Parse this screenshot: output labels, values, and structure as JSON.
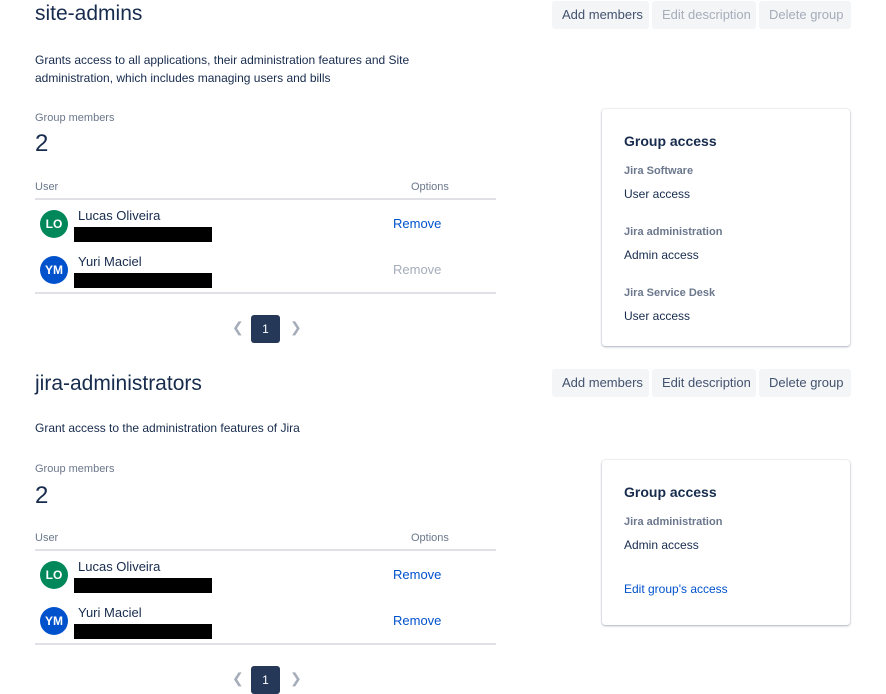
{
  "groups": [
    {
      "name": "site-admins",
      "buttons": {
        "add": "Add members",
        "edit": "Edit description",
        "delete": "Delete group"
      },
      "description": "Grants access to all applications, their administration features and Site administration, which includes managing users and bills",
      "members_label": "Group members",
      "members_count": "2",
      "table": {
        "col_user": "User",
        "col_options": "Options",
        "rows": [
          {
            "initials": "LO",
            "name": "Lucas Oliveira",
            "action": "Remove",
            "avatar_color": "#00875a"
          },
          {
            "initials": "YM",
            "name": "Yuri Maciel",
            "action": "Remove",
            "avatar_color": "#0052cc"
          }
        ]
      },
      "pagination": {
        "current_page": "1"
      },
      "access": {
        "title": "Group access",
        "items": [
          {
            "product": "Jira Software",
            "level": "User access"
          },
          {
            "product": "Jira administration",
            "level": "Admin access"
          },
          {
            "product": "Jira Service Desk",
            "level": "User access"
          }
        ]
      }
    },
    {
      "name": "jira-administrators",
      "buttons": {
        "add": "Add members",
        "edit": "Edit description",
        "delete": "Delete group"
      },
      "description": "Grant access to the administration features of Jira",
      "members_label": "Group members",
      "members_count": "2",
      "table": {
        "col_user": "User",
        "col_options": "Options",
        "rows": [
          {
            "initials": "LO",
            "name": "Lucas Oliveira",
            "action": "Remove",
            "avatar_color": "#00875a"
          },
          {
            "initials": "YM",
            "name": "Yuri Maciel",
            "action": "Remove",
            "avatar_color": "#0052cc"
          }
        ]
      },
      "pagination": {
        "current_page": "1"
      },
      "access": {
        "title": "Group access",
        "items": [
          {
            "product": "Jira administration",
            "level": "Admin access"
          }
        ],
        "edit_link": "Edit group's access"
      }
    }
  ],
  "icons": {
    "prev": "chevron-left-icon",
    "next": "chevron-right-icon"
  },
  "colors": {
    "link": "#0052cc",
    "page_active": "#253858",
    "disabled": "#a5adba"
  }
}
